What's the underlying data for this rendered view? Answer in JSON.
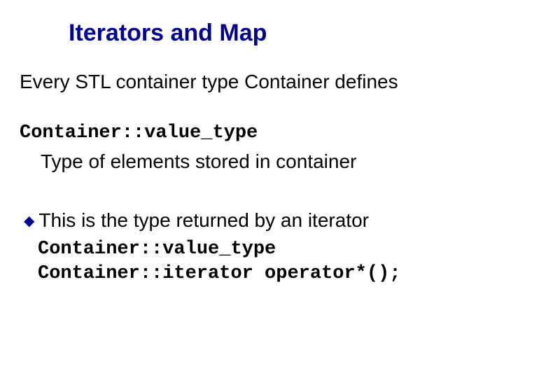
{
  "title": "Iterators and Map",
  "intro": "Every STL container type Container defines",
  "codeHeader": "Container::value_type",
  "codeDesc": "Type of elements stored in container",
  "bullet": {
    "text": "This is the type returned by an iterator"
  },
  "codeLine1": "Container::value_type",
  "codeLine2": "Container::iterator operator*();"
}
